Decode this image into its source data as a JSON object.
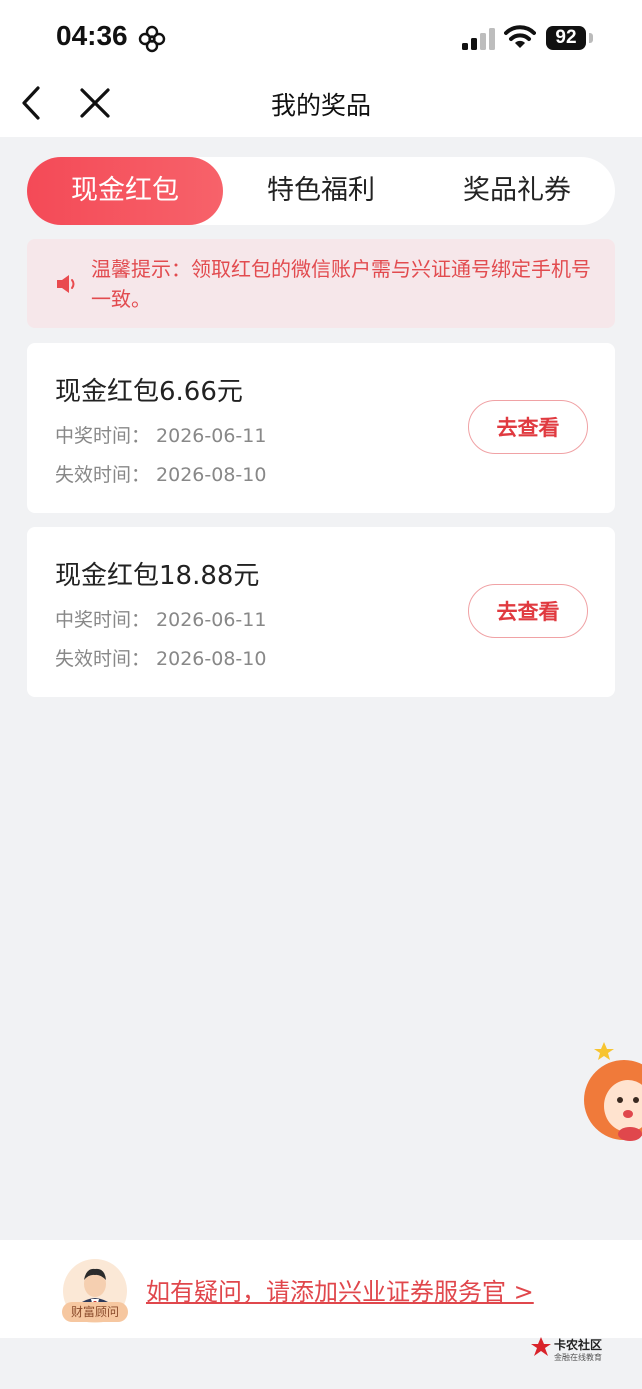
{
  "status_bar": {
    "time": "04:36",
    "battery": "92"
  },
  "nav": {
    "title": "我的奖品"
  },
  "tabs": [
    {
      "label": "现金红包",
      "active": true
    },
    {
      "label": "特色福利",
      "active": false
    },
    {
      "label": "奖品礼券",
      "active": false
    }
  ],
  "notice": {
    "text": "温馨提示：领取红包的微信账户需与兴证通号绑定手机号一致。"
  },
  "prizes": [
    {
      "title": "现金红包6.66元",
      "win_label": "中奖时间：",
      "win_date": "2026-06-11",
      "expire_label": "失效时间：",
      "expire_date": "2026-08-10",
      "button": "去查看"
    },
    {
      "title": "现金红包18.88元",
      "win_label": "中奖时间：",
      "win_date": "2026-06-11",
      "expire_label": "失效时间：",
      "expire_date": "2026-08-10",
      "button": "去查看"
    }
  ],
  "footer": {
    "advisor_badge": "财富顾问",
    "help_text": "如有疑问，请添加兴业证券服务官 >"
  },
  "watermark": {
    "title": "卡农社区",
    "subtitle": "金融在线教育"
  },
  "colors": {
    "accent": "#f44a57",
    "notice_bg": "#f6e7ea",
    "page_bg": "#f1f2f4"
  }
}
